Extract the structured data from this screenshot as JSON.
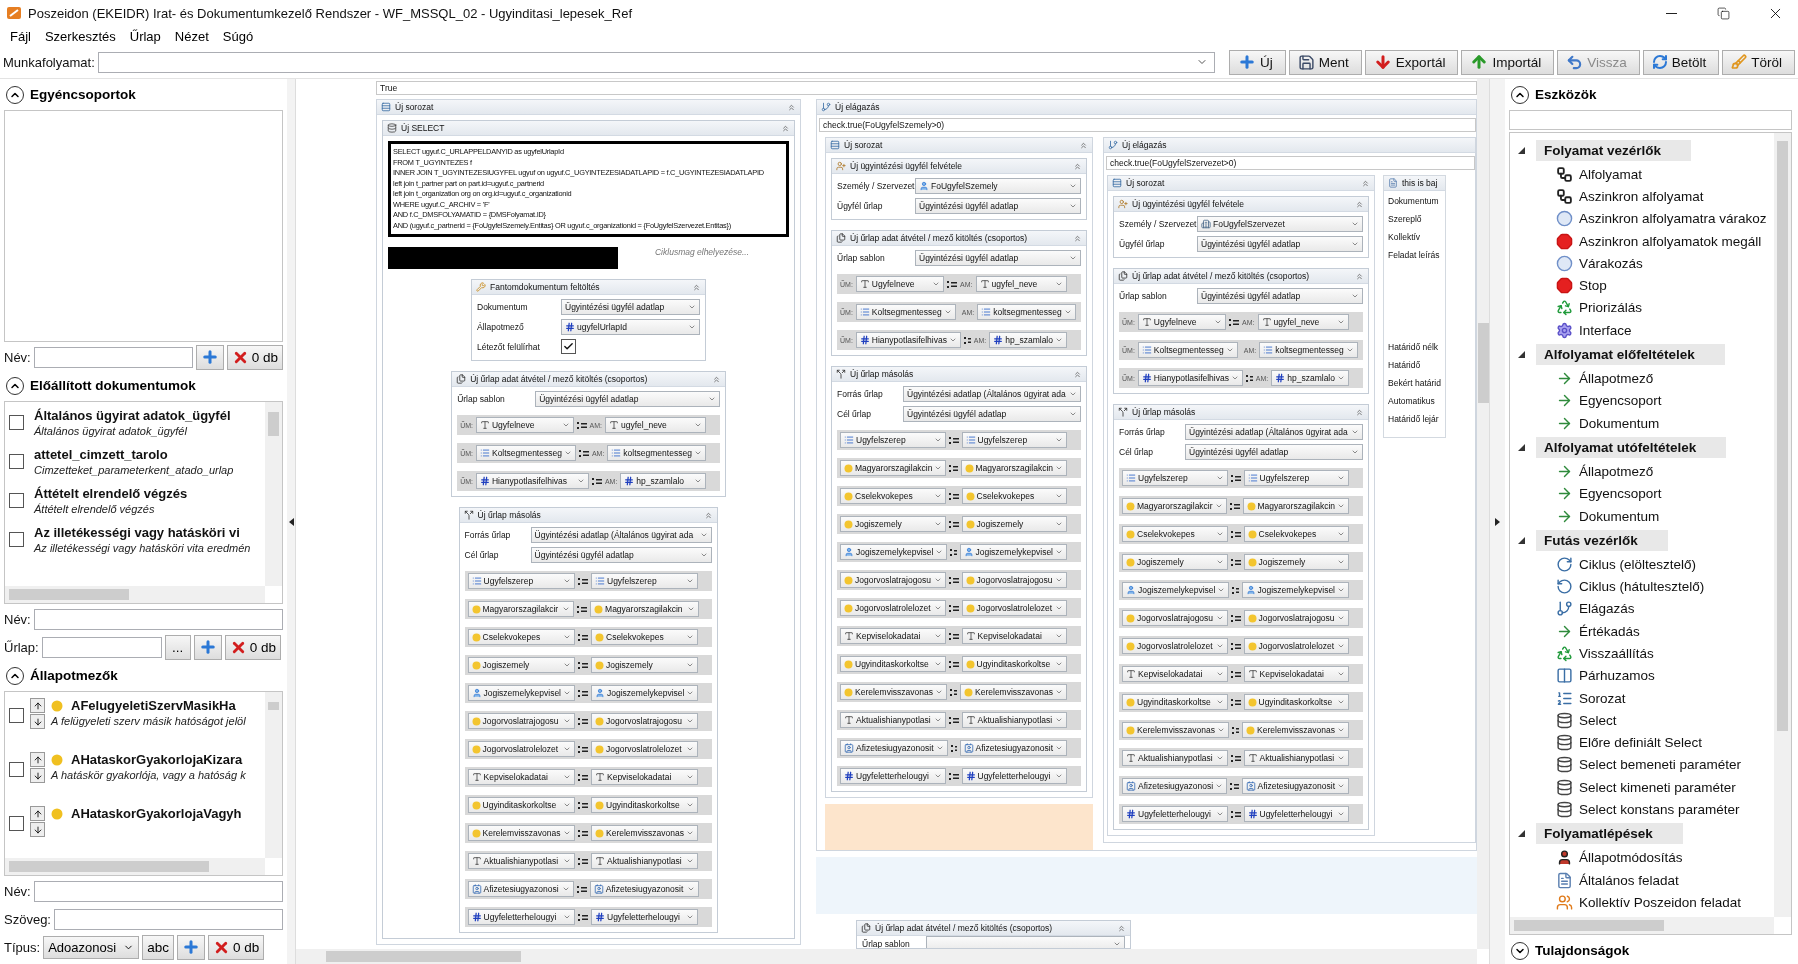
{
  "window": {
    "title": "Poszeidon (EKEIDR) Irat- és Dokumentumkezelő Rendszer - WF_MSSQL_02 - Ugyinditasi_lepesek_Ref"
  },
  "menu": [
    "Fájl",
    "Szerkesztés",
    "Űrlap",
    "Nézet",
    "Súgó"
  ],
  "workflow": {
    "label": "Munkafolyamat:"
  },
  "toolbar": [
    {
      "label": "Új",
      "kind": "add",
      "disabled": false
    },
    {
      "label": "Ment",
      "kind": "save",
      "disabled": false
    },
    {
      "label": "Exportál",
      "kind": "export",
      "disabled": false
    },
    {
      "label": "Importál",
      "kind": "import",
      "disabled": false
    },
    {
      "label": "Vissza",
      "kind": "undo",
      "disabled": true
    },
    {
      "label": "Betölt",
      "kind": "reload",
      "disabled": false
    },
    {
      "label": "Töröl",
      "kind": "clear",
      "disabled": false
    }
  ],
  "left": {
    "groups": {
      "title": "Egyéncsoportok",
      "expanded": true,
      "name_label": "Név:",
      "count": "0 db"
    },
    "documents": {
      "title": "Előállított dokumentumok",
      "expanded": true,
      "items": [
        {
          "title": "Általános ügyirat adatok_ügyfél",
          "subtitle": "Általános ügyirat adatok_ügyfél",
          "checked": false
        },
        {
          "title": "attetel_cimzett_tarolo",
          "subtitle": "Cimzetteket_parameterkent_atado_urlap",
          "checked": false
        },
        {
          "title": "Áttételt elrendelő végzés",
          "subtitle": "Áttételt elrendelő végzés",
          "checked": false
        },
        {
          "title": "Az illetékességi vagy hatásköri vi",
          "subtitle": "Az illetékességi vagy hatásköri vita eredmén",
          "checked": false
        }
      ],
      "name_label": "Név:",
      "form_label": "Űrlap:",
      "browse": "...",
      "count": "0 db"
    },
    "fields": {
      "title": "Állapotmezők",
      "expanded": true,
      "items": [
        {
          "name": "AFelugyeletiSzervMasikHa",
          "description": "A felügyeleti szerv másik hatóságot jelöl",
          "checked": false
        },
        {
          "name": "AHataskorGyakorlojaKizara",
          "description": "A hatáskör gyakorlója, vagy a hatóság k",
          "checked": false
        },
        {
          "name": "AHataskorGyakorlojaVagyh",
          "checked": false
        }
      ],
      "name_label": "Név:",
      "text_label": "Szöveg:",
      "type_label": "Típus:",
      "type_value": "Adoazonosi",
      "abc": "abc",
      "count": "0 db"
    }
  },
  "canvas": {
    "condition": "True",
    "main": {
      "title": "Új sorozat",
      "select": {
        "title": "Új SELECT",
        "sql": [
          "SELECT ugyuf.C_URLAPPELDANYID as ugyfelUrlapId",
          "FROM T_UGYINTEZES f",
          "INNER JOIN T_UGYINTEZESIUGYFEL ugyuf on ugyuf.C_UGYINTEZESIADATLAPID = f.C_UGYINTEZESIADATLAPID",
          "left join t_partner part on part.id=ugyuf.c_partnerid",
          "left join t_organization org on org.id=ugyuf.c_organizationid",
          "WHERE ugyuf.C_ARCHIV = 'F'",
          "AND f.C_DMSFOLYAMATID = {DMSFolyamat.ID}",
          "AND (ugyuf.c_partnerid = {FoUgyfelSzemely.Entitas} OR ugyuf.c_organizationid = {FoUgyfelSzervezet.Entitas})"
        ],
        "hint": "Ciklusmag elhelyezése..."
      },
      "steps": [
        {
          "kind": "phantom",
          "title": "Fantomdokumentum feltöltés",
          "fields": [
            {
              "kind": "select",
              "label": "Dokumentum",
              "value": "Ügyintézési ügyfél adatlap"
            },
            {
              "kind": "number-select",
              "label": "Állapotmező",
              "value": "ugyfelUrlapId"
            },
            {
              "kind": "checkbox",
              "label": "Létezőt felülírhat",
              "checked": true
            }
          ]
        },
        {
          "kind": "fill",
          "title": "Új űrlap adat átvétel / mező kitöltés (csoportos)",
          "fields": [
            {
              "kind": "select",
              "label": "Űrlap sablon",
              "value": "Ügyintézési ügyfél adatlap"
            }
          ],
          "rows": [
            {
              "kind": "text",
              "source_prefix": "ŰM:",
              "source": "Ugyfelneve",
              "target_prefix": "AM:",
              "target": "ugyfel_neve"
            },
            {
              "kind": "list",
              "source_prefix": "ŰM:",
              "source": "Koltsegmentesseg",
              "target_prefix": "AM:",
              "target": "koltsegmentesseg"
            },
            {
              "kind": "number",
              "source_prefix": "ŰM:",
              "source": "Hianypotlasifelhivas",
              "target_prefix": "AM:",
              "target": "hp_szamlalo"
            }
          ]
        },
        {
          "kind": "copy",
          "title": "Új űrlap másolás",
          "fields": [
            {
              "kind": "select",
              "label": "Forrás űrlap",
              "value": "Ügyintézési adatlap (Általános ügyirat ada"
            },
            {
              "kind": "select",
              "label": "Cél űrlap",
              "value": "Ügyintézési ügyfél adatlap"
            }
          ],
          "rows": [
            {
              "kind": "list",
              "source": "Ugyfelszerep",
              "target": "Ugyfelszerep"
            },
            {
              "kind": "status",
              "source": "Magyarorszagilakcir",
              "target": "Magyarorszagilakcin"
            },
            {
              "kind": "status",
              "source": "Cselekvokepes",
              "target": "Cselekvokepes"
            },
            {
              "kind": "status",
              "source": "Jogiszemely",
              "target": "Jogiszemely"
            },
            {
              "kind": "person",
              "source": "Jogiszemelykepvisel",
              "target": "Jogiszemelykepvisel"
            },
            {
              "kind": "status",
              "source": "Jogorvoslatrajogosu",
              "target": "Jogorvoslatrajogosu"
            },
            {
              "kind": "status",
              "source": "Jogorvoslatrolelozet",
              "target": "Jogorvoslatrolelozet"
            },
            {
              "kind": "text",
              "source": "Kepviselokadatai",
              "target": "Kepviselokadatai"
            },
            {
              "kind": "status",
              "source": "Ugyinditaskorkoltse",
              "target": "Ugyinditaskorkoltse"
            },
            {
              "kind": "status",
              "source": "Kerelemvisszavonas",
              "target": "Kerelemvisszavonas"
            },
            {
              "kind": "text",
              "source": "Aktualishianypotlasi",
              "target": "Aktualishianypotlasi"
            },
            {
              "kind": "id",
              "source": "Afizetesiugyazonosi",
              "target": "Afizetesiugyazonosit"
            },
            {
              "kind": "number",
              "source": "Ugyfeletterhelougyi",
              "target": "Ugyfeletterhelougyi"
            }
          ]
        }
      ]
    },
    "branch": {
      "title": "Új elágazás",
      "condition": "check.true(FoUgyfelSzemely>0)",
      "sequence": {
        "title": "Új sorozat",
        "steps": [
          {
            "kind": "client",
            "title": "Új ügyintézési ügyfél felvétele",
            "fields": [
              {
                "kind": "person-select",
                "label": "Személy / Szervezet",
                "value": "FoUgyfelSzemely"
              },
              {
                "kind": "select",
                "label": "Ügyfél űrlap",
                "value": "Ügyintézési ügyfél adatlap"
              }
            ]
          },
          {
            "kind": "fill",
            "title": "Új űrlap adat átvétel / mező kitöltés (csoportos)",
            "fields": [
              {
                "kind": "select",
                "label": "Űrlap sablon",
                "value": "Ügyintézési ügyfél adatlap"
              }
            ],
            "rows": [
              {
                "kind": "text",
                "source_prefix": "ŰM:",
                "source": "Ugyfelneve",
                "target_prefix": "AM:",
                "target": "ugyfel_neve"
              },
              {
                "kind": "list",
                "source_prefix": "ŰM:",
                "source": "Koltsegmentesseg",
                "target_prefix": "AM:",
                "target": "koltsegmentesseg"
              },
              {
                "kind": "number",
                "source_prefix": "ŰM:",
                "source": "Hianypotlasifelhivas",
                "target_prefix": "AM:",
                "target": "hp_szamlalo"
              }
            ]
          },
          {
            "kind": "copy",
            "title": "Új űrlap másolás",
            "fields": [
              {
                "kind": "select",
                "label": "Forrás űrlap",
                "value": "Ügyintézési adatlap (Általános ügyirat ada"
              },
              {
                "kind": "select",
                "label": "Cél űrlap",
                "value": "Ügyintézési ügyfél adatlap"
              }
            ],
            "rows": [
              {
                "kind": "list",
                "source": "Ugyfelszerep",
                "target": "Ugyfelszerep"
              },
              {
                "kind": "status",
                "source": "Magyarorszagilakcin",
                "target": "Magyarorszagilakcin"
              },
              {
                "kind": "status",
                "source": "Cselekvokepes",
                "target": "Cselekvokepes"
              },
              {
                "kind": "status",
                "source": "Jogiszemely",
                "target": "Jogiszemely"
              },
              {
                "kind": "person",
                "source": "Jogiszemelykepvisel",
                "target": "Jogiszemelykepvisel"
              },
              {
                "kind": "status",
                "source": "Jogorvoslatrajogosu",
                "target": "Jogorvoslatrajogosu"
              },
              {
                "kind": "status",
                "source": "Jogorvoslatrolelozet",
                "target": "Jogorvoslatrolelozet"
              },
              {
                "kind": "text",
                "source": "Kepviselokadatai",
                "target": "Kepviselokadatai"
              },
              {
                "kind": "status",
                "source": "Ugyinditaskorkoltse",
                "target": "Ugyinditaskorkoltse"
              },
              {
                "kind": "status",
                "source": "Kerelemvisszavonas",
                "target": "Kerelemvisszavonas"
              },
              {
                "kind": "text",
                "source": "Aktualishianypotlasi",
                "target": "Aktualishianypotlasi"
              },
              {
                "kind": "id",
                "source": "Afizetesiugyazonosit",
                "target": "Afizetesiugyazonosit"
              },
              {
                "kind": "number",
                "source": "Ugyfeletterhelougyi",
                "target": "Ugyfeletterhelougyi"
              }
            ]
          }
        ]
      },
      "else": {
        "title": "Új elágazás",
        "condition": "check.true(FoUgyfelSzervezet>0)",
        "sequence": {
          "title": "Új sorozat",
          "steps": [
            {
              "kind": "client",
              "title": "Új ügyintézési ügyfél felvétele",
              "fields": [
                {
                  "kind": "org-select",
                  "label": "Személy / Szervezet",
                  "value": "FoUgyfelSzervezet"
                },
                {
                  "kind": "select",
                  "label": "Ügyfél űrlap",
                  "value": "Ügyintézési ügyfél adatlap"
                }
              ]
            },
            {
              "kind": "fill",
              "title": "Új űrlap adat átvétel / mező kitöltés (csoportos)",
              "fields": [
                {
                  "kind": "select",
                  "label": "Űrlap sablon",
                  "value": "Ügyintézési ügyfél adatlap"
                }
              ],
              "rows": [
                {
                  "kind": "text",
                  "source_prefix": "ŰM:",
                  "source": "Ugyfelneve",
                  "target_prefix": "AM:",
                  "target": "ugyfel_neve"
                },
                {
                  "kind": "list",
                  "source_prefix": "ŰM:",
                  "source": "Koltsegmentesseg",
                  "target_prefix": "AM:",
                  "target": "koltsegmentesseg"
                },
                {
                  "kind": "number",
                  "source_prefix": "ŰM:",
                  "source": "Hianypotlasifelhivas",
                  "target_prefix": "AM:",
                  "target": "hp_szamlalo"
                }
              ]
            },
            {
              "kind": "copy",
              "title": "Új űrlap másolás",
              "fields": [
                {
                  "kind": "select",
                  "label": "Forrás űrlap",
                  "value": "Ügyintézési adatlap (Általános ügyirat ada"
                },
                {
                  "kind": "select",
                  "label": "Cél űrlap",
                  "value": "Ügyintézési ügyfél adatlap"
                }
              ],
              "rows": [
                {
                  "kind": "list",
                  "source": "Ugyfelszerep",
                  "target": "Ugyfelszerep"
                },
                {
                  "kind": "status",
                  "source": "Magyarorszagilakcir",
                  "target": "Magyarorszagilakcin"
                },
                {
                  "kind": "status",
                  "source": "Cselekvokepes",
                  "target": "Cselekvokepes"
                },
                {
                  "kind": "status",
                  "source": "Jogiszemely",
                  "target": "Jogiszemely"
                },
                {
                  "kind": "person",
                  "source": "Jogiszemelykepvisel",
                  "target": "Jogiszemelykepvisel"
                },
                {
                  "kind": "status",
                  "source": "Jogorvoslatrajogosu",
                  "target": "Jogorvoslatrajogosu"
                },
                {
                  "kind": "status",
                  "source": "Jogorvoslatrolelozet",
                  "target": "Jogorvoslatrolelozet"
                },
                {
                  "kind": "text",
                  "source": "Kepviselokadatai",
                  "target": "Kepviselokadatai"
                },
                {
                  "kind": "status",
                  "source": "Ugyinditaskorkoltse",
                  "target": "Ugyinditaskorkoltse"
                },
                {
                  "kind": "status",
                  "source": "Kerelemvisszavonas",
                  "target": "Kerelemvisszavonas"
                },
                {
                  "kind": "text",
                  "source": "Aktualishianypotlasi",
                  "target": "Aktualishianypotlasi"
                },
                {
                  "kind": "id",
                  "source": "Afizetesiugyazonosi",
                  "target": "Afizetesiugyazonosit"
                },
                {
                  "kind": "number",
                  "source": "Ugyfeletterhelougyi",
                  "target": "Ugyfeletterhelougyi"
                }
              ]
            }
          ]
        },
        "task": {
          "title": "this is baj",
          "labels": [
            {
              "kind": "line",
              "label": "Dokumentum"
            },
            {
              "kind": "line",
              "label": "Szereplő"
            },
            {
              "kind": "line",
              "label": "Kollektív"
            },
            {
              "kind": "multiline",
              "label": "Feladat leírás"
            },
            {
              "kind": "line",
              "label": "Határidő nélk"
            },
            {
              "kind": "line",
              "label": "Határidő"
            },
            {
              "kind": "line",
              "label": "Bekért határid"
            },
            {
              "kind": "line",
              "label": "Automatikus"
            },
            {
              "kind": "line",
              "label": "Határidő lejár"
            }
          ]
        }
      }
    },
    "trailing": {
      "kind": "fill",
      "title": "Új űrlap adat átvétel / mező kitöltés (csoportos)",
      "fields": [
        {
          "kind": "select",
          "label": "Űrlap sablon"
        }
      ]
    }
  },
  "tools": {
    "title": "Eszközök",
    "expanded": true,
    "groups": [
      {
        "title": "Folyamat vezérlők",
        "expanded": true,
        "items": [
          {
            "label": "Alfolyamat",
            "kind": "subprocess"
          },
          {
            "label": "Aszinkron alfolyamat",
            "kind": "subprocess"
          },
          {
            "label": "Aszinkron alfolyamatra várakoz",
            "kind": "clock"
          },
          {
            "label": "Aszinkron alfolyamatok megáll",
            "kind": "stop"
          },
          {
            "label": "Várakozás",
            "kind": "clock"
          },
          {
            "label": "Stop",
            "kind": "stop"
          },
          {
            "label": "Priorizálás",
            "kind": "recycle"
          },
          {
            "label": "Interface",
            "kind": "gear"
          }
        ]
      },
      {
        "title": "Alfolyamat előfeltételek",
        "expanded": true,
        "items": [
          {
            "label": "Állapotmező",
            "kind": "ab"
          },
          {
            "label": "Egyencsoport",
            "kind": "ab"
          },
          {
            "label": "Dokumentum",
            "kind": "ab"
          }
        ]
      },
      {
        "title": "Alfolyamat utófeltételek",
        "expanded": true,
        "items": [
          {
            "label": "Állapotmező",
            "kind": "ab"
          },
          {
            "label": "Egyencsoport",
            "kind": "ab"
          },
          {
            "label": "Dokumentum",
            "kind": "ab"
          }
        ]
      },
      {
        "title": "Futás vezérlők",
        "expanded": true,
        "items": [
          {
            "label": "Ciklus (elöltesztelő)",
            "kind": "loop"
          },
          {
            "label": "Ciklus (hátultesztelő)",
            "kind": "loopback"
          },
          {
            "label": "Elágazás",
            "kind": "branch"
          },
          {
            "label": "Értékadás",
            "kind": "ab"
          },
          {
            "label": "Visszaállítás",
            "kind": "recycle"
          },
          {
            "label": "Párhuzamos",
            "kind": "parallel"
          },
          {
            "label": "Sorozat",
            "kind": "sequence"
          },
          {
            "label": "Select",
            "kind": "db"
          },
          {
            "label": "Előre definiált Select",
            "kind": "db"
          },
          {
            "label": "Select bemeneti paraméter",
            "kind": "db"
          },
          {
            "label": "Select kimeneti paraméter",
            "kind": "db"
          },
          {
            "label": "Select konstans paraméter",
            "kind": "db"
          }
        ]
      },
      {
        "title": "Folyamatlépések",
        "expanded": true,
        "items": [
          {
            "label": "Állapotmódosítás",
            "kind": "person"
          },
          {
            "label": "Általános feladat",
            "kind": "task"
          },
          {
            "label": "Kollektív Poszeidon feladat",
            "kind": "collective"
          }
        ]
      }
    ]
  },
  "properties": {
    "title": "Tulajdonságok",
    "expanded": false
  }
}
